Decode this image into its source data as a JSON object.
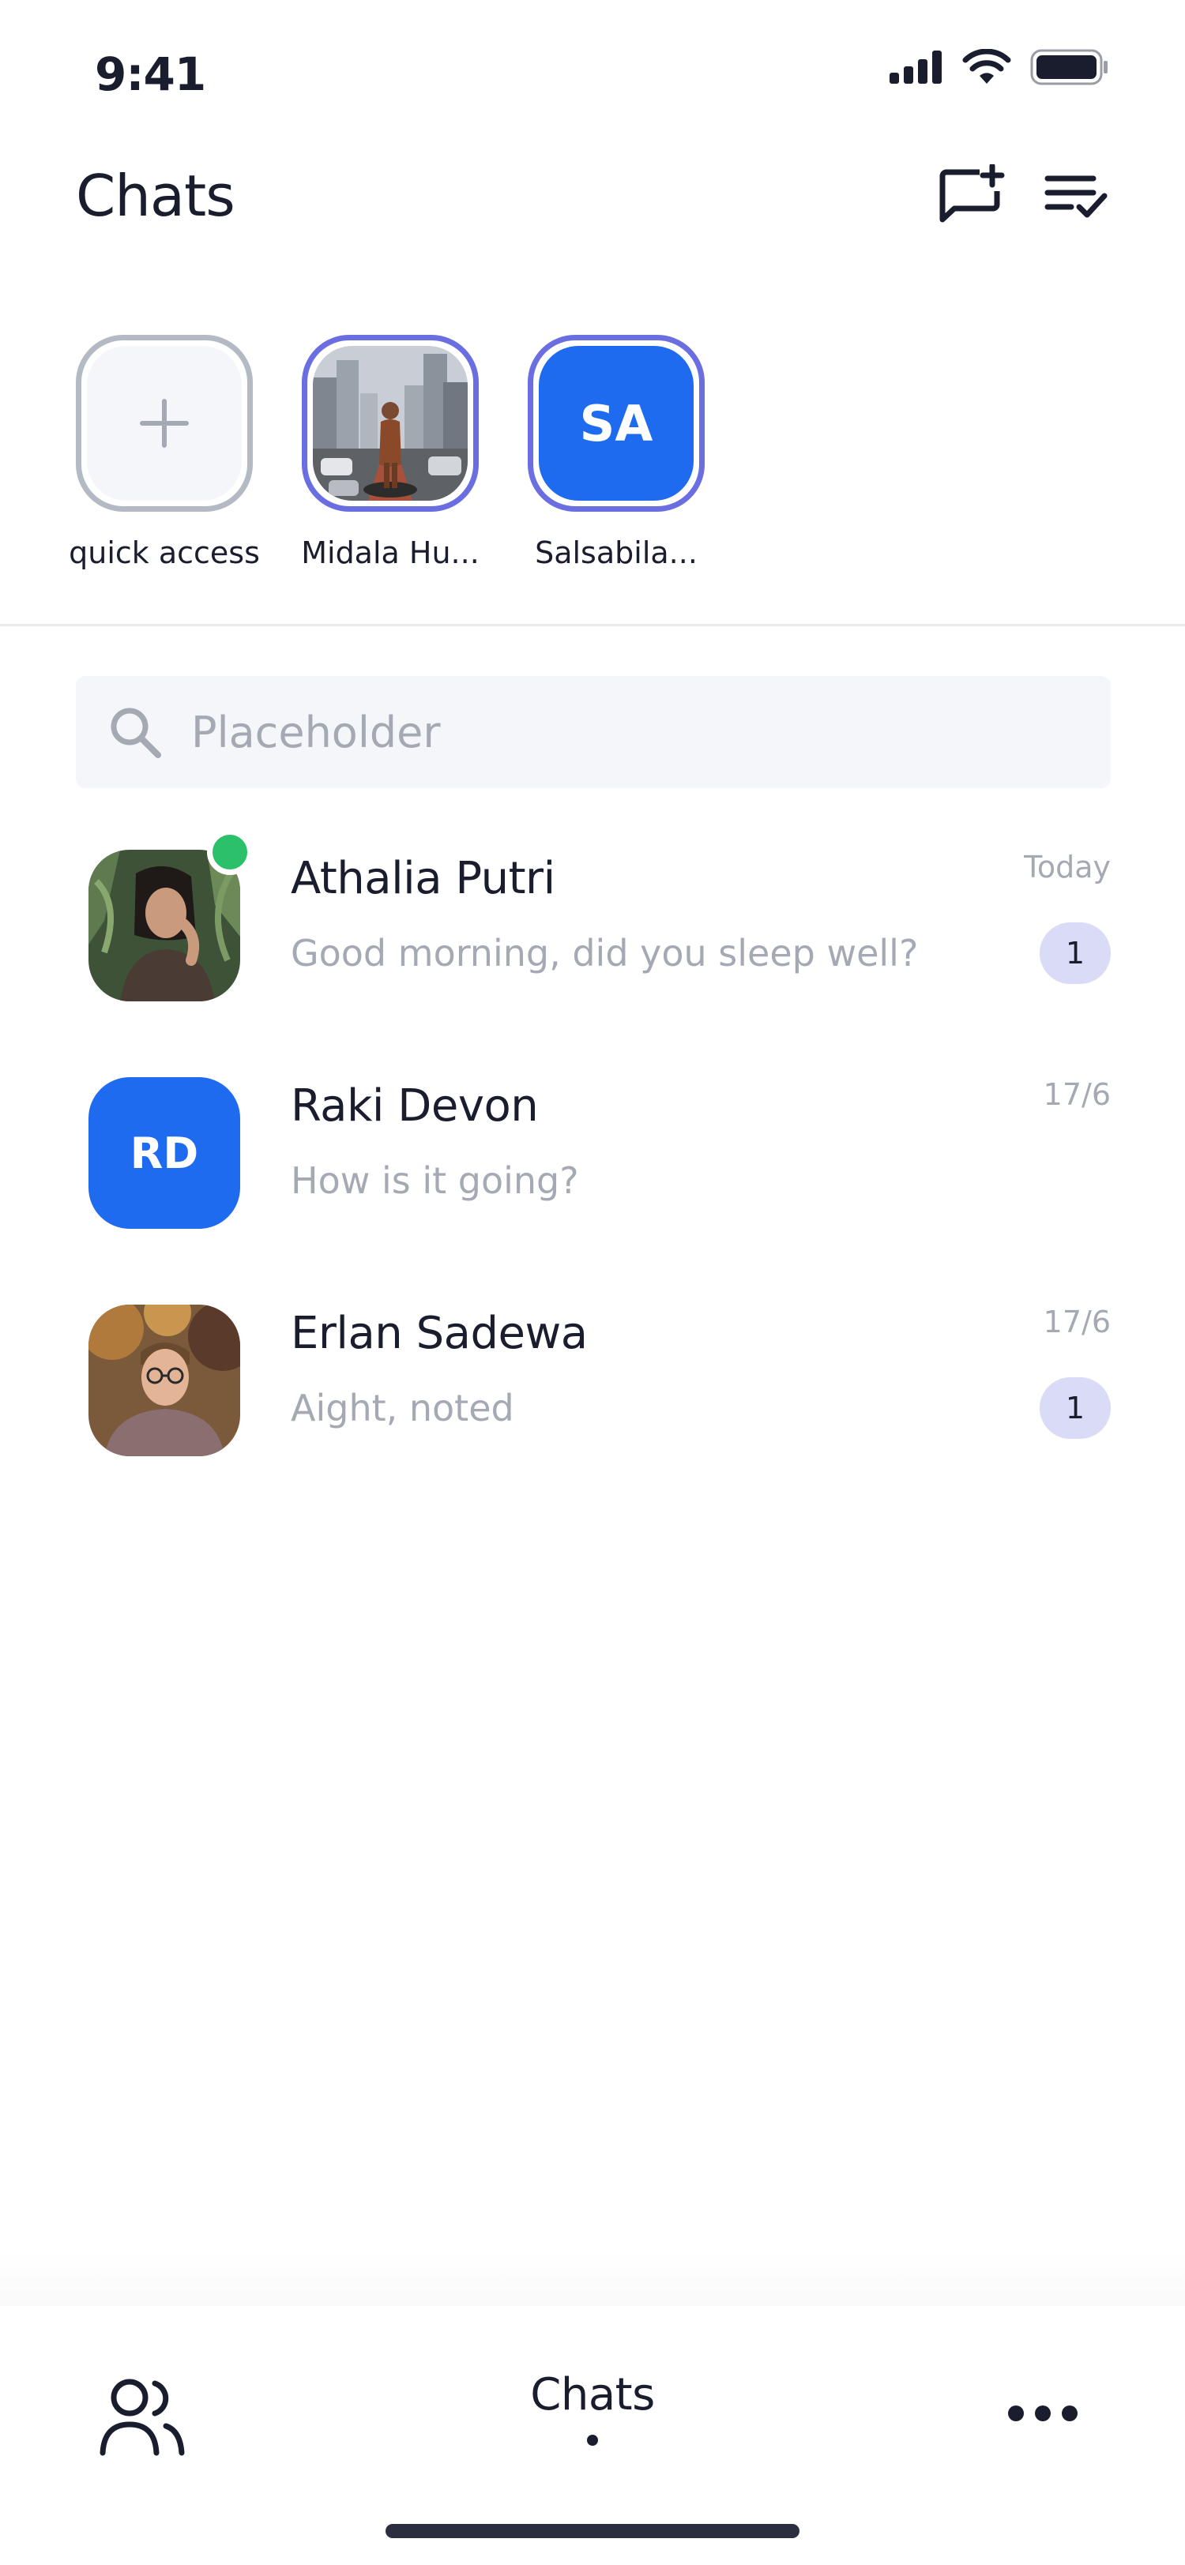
{
  "status_bar": {
    "time": "9:41"
  },
  "header": {
    "title": "Chats",
    "icons": [
      "new-chat-icon",
      "filter-list-icon"
    ]
  },
  "stories": [
    {
      "label": "quick access",
      "type": "add",
      "icon": "plus-icon"
    },
    {
      "label": "Midala Hu...",
      "type": "photo"
    },
    {
      "label": "Salsabila...",
      "type": "initials",
      "initials": "SA"
    }
  ],
  "search": {
    "placeholder": "Placeholder",
    "icon": "search-icon"
  },
  "chats": [
    {
      "name": "Athalia Putri",
      "message": "Good morning, did you sleep well?",
      "time": "Today",
      "unread": "1",
      "online": true
    },
    {
      "name": "Raki Devon",
      "message": "How is it going?",
      "time": "17/6",
      "initials": "RD"
    },
    {
      "name": "Erlan Sadewa",
      "message": "Aight, noted",
      "time": "17/6",
      "unread": "1"
    }
  ],
  "bottom_nav": {
    "contacts_icon": "contacts-icon",
    "chats_label": "Chats",
    "more_icon": "more-icon"
  },
  "colors": {
    "accent": "#1e6bf0",
    "ring": "#6a6ee0",
    "online": "#2bc06a",
    "badge": "#d9dbf7",
    "muted": "#a4a9b3"
  }
}
